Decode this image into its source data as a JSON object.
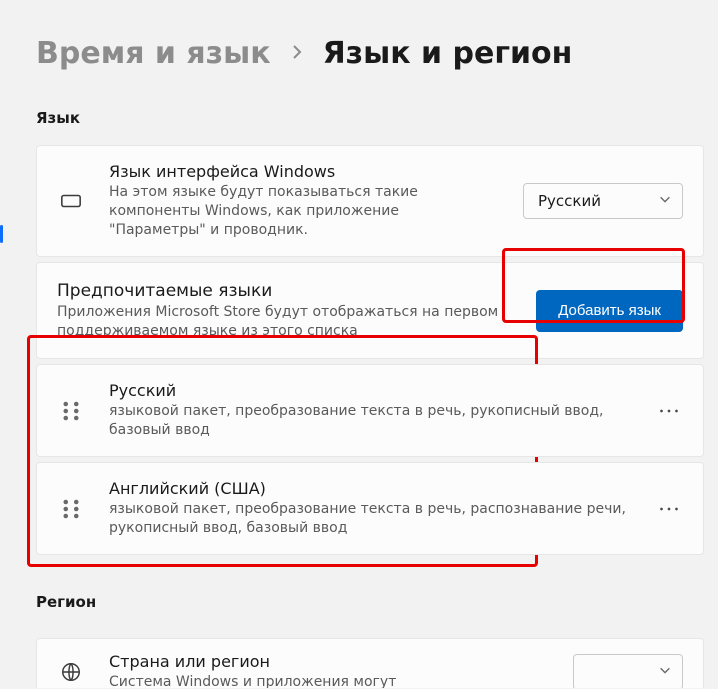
{
  "breadcrumb": {
    "parent": "Время и язык",
    "current": "Язык и регион"
  },
  "sections": {
    "language_label": "Язык",
    "region_label": "Регион"
  },
  "display_language": {
    "title": "Язык интерфейса Windows",
    "desc": "На этом языке будут показываться такие компоненты Windows, как приложение \"Параметры\" и проводник.",
    "selected": "Русский"
  },
  "preferred": {
    "title": "Предпочитаемые языки",
    "desc": "Приложения Microsoft Store будут отображаться на первом поддерживаемом языке из этого списка",
    "add_label": "Добавить язык"
  },
  "languages": [
    {
      "name": "Русский",
      "detail": "языковой пакет, преобразование текста в речь, рукописный ввод, базовый ввод"
    },
    {
      "name": "Английский (США)",
      "detail": "языковой пакет, преобразование текста в речь, распознавание речи, рукописный ввод, базовый ввод"
    }
  ],
  "region": {
    "title": "Страна или регион",
    "desc": "Система Windows и приложения могут"
  }
}
